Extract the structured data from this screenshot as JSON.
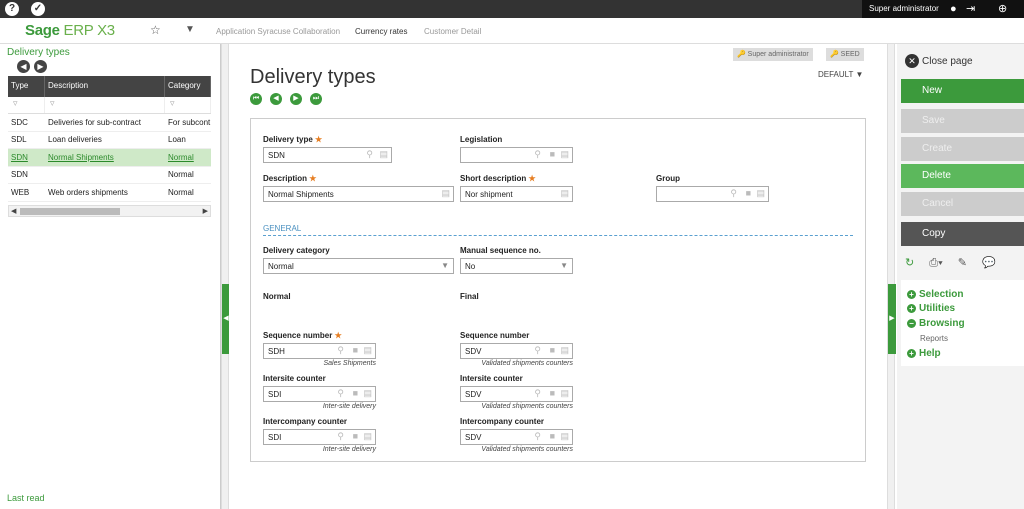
{
  "topbar": {
    "help_icon": "?",
    "check_icon": "✓",
    "user_name": "Super administrator"
  },
  "nav": {
    "logo_sage": "Sage",
    "logo_erp": "ERP X3",
    "links": [
      "Application Syracuse Collaboration",
      "Currency rates",
      "Customer Detail"
    ]
  },
  "left": {
    "title": "Delivery types",
    "columns": [
      "Type",
      "Description",
      "Category"
    ],
    "rows": [
      {
        "type": "SDC",
        "description": "Deliveries for sub-contract",
        "category": "For subcont"
      },
      {
        "type": "SDL",
        "description": "Loan deliveries",
        "category": "Loan"
      },
      {
        "type": "SDN",
        "description": "Normal Shipments",
        "category": "Normal"
      },
      {
        "type": "SDN",
        "description": "",
        "category": "Normal"
      },
      {
        "type": "WEB",
        "description": "Web orders shipments",
        "category": "Normal"
      }
    ],
    "last_read": "Last read"
  },
  "main": {
    "badge_user": "Super administrator",
    "badge_folder": "SEED",
    "default_label": "DEFAULT",
    "title": "Delivery types",
    "fields": {
      "delivery_type_label": "Delivery type",
      "delivery_type_value": "SDN",
      "legislation_label": "Legislation",
      "legislation_value": "",
      "description_label": "Description",
      "description_value": "Normal Shipments",
      "short_desc_label": "Short description",
      "short_desc_value": "Nor shipment",
      "group_label": "Group",
      "group_value": "",
      "section_general": "GENERAL",
      "delivery_category_label": "Delivery category",
      "delivery_category_value": "Normal",
      "manual_seq_label": "Manual sequence no.",
      "manual_seq_value": "No",
      "normal_text": "Normal",
      "final_text": "Final",
      "seq_number_label": "Sequence number",
      "seq_left_value": "SDH",
      "seq_left_sub": "Sales Shipments",
      "seq_right_value": "SDV",
      "seq_right_sub": "Validated shipments counters",
      "intersite_label": "Intersite counter",
      "intersite_left_value": "SDI",
      "intersite_left_sub": "Inter-site delivery",
      "intersite_right_value": "SDV",
      "intersite_right_sub": "Validated shipments counters",
      "intercompany_label": "Intercompany counter",
      "intercompany_left_value": "SDI",
      "intercompany_left_sub": "Inter-site delivery",
      "intercompany_right_value": "SDV",
      "intercompany_right_sub": "Validated shipments counters"
    }
  },
  "right": {
    "close_page": "Close page",
    "buttons": [
      "New",
      "Save",
      "Create",
      "Delete",
      "Cancel",
      "Copy"
    ],
    "menu": {
      "selection": "Selection",
      "utilities": "Utilities",
      "browsing": "Browsing",
      "reports": "Reports",
      "help": "Help"
    }
  },
  "colors": {
    "accent": "#3c9a3c",
    "topbar": "#333333",
    "required": "#e67e22"
  }
}
